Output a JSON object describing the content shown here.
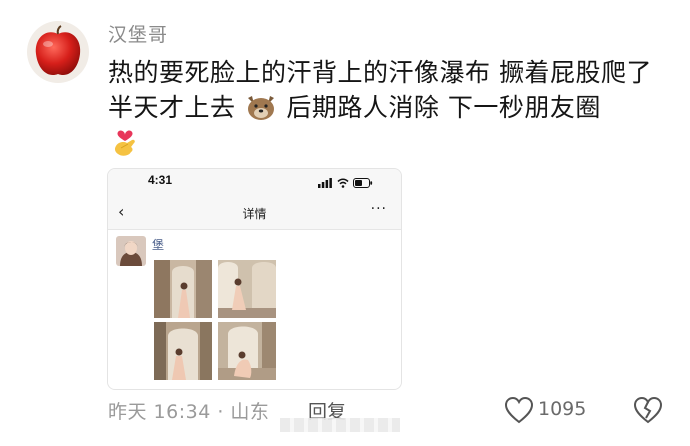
{
  "comment": {
    "username": "汉堡哥",
    "text_part1": "热的要死脸上的汗背上的汗像瀑布 撅着屁股爬了半天才上去",
    "text_part2": "后期路人消除 下一秒朋友圈",
    "time_location": "昨天 16:34 · 山东",
    "reply_label": "回复",
    "like_count": "1095"
  },
  "screenshot": {
    "status_time": "4:31",
    "page_title": "详情",
    "more_label": "···",
    "post_author": "堡"
  },
  "icons": [
    "apple-avatar-icon",
    "dog-emoji-icon",
    "heart-hand-emoji-icon",
    "back-icon",
    "signal-icon",
    "wifi-icon",
    "battery-icon",
    "like-icon",
    "dislike-icon"
  ],
  "colors": {
    "username": "#8a8a8a",
    "meta": "#9a9a9a",
    "author_link": "#4a5e8a"
  }
}
